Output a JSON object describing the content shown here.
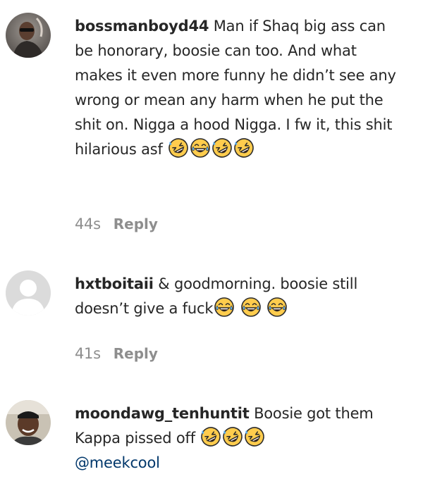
{
  "comments": [
    {
      "username": "bossmanboyd44",
      "text": " Man if Shaq big ass can be honorary, boosie can too. And what makes it even more funny he didn’t see any wrong or mean any harm when he put the shit on. Nigga a hood Nigga. I fw it, this shit hilarious asf",
      "emojis": [
        "rolling-laughing-emoji",
        "tears-of-joy-emoji",
        "rolling-laughing-emoji",
        "rolling-laughing-emoji"
      ],
      "time": "44s",
      "reply_label": "Reply",
      "avatar": "profile-photo"
    },
    {
      "username": "hxtboitaii",
      "text": " & goodmorning. boosie still doesn’t give a fuck",
      "emojis": [
        "tears-of-joy-emoji",
        "tears-of-joy-emoji",
        "tears-of-joy-emoji"
      ],
      "time": "41s",
      "reply_label": "Reply",
      "avatar": "default-avatar"
    },
    {
      "username": "moondawg_tenhuntit",
      "text": " Boosie got them Kappa pissed off",
      "emojis": [
        "rolling-laughing-emoji",
        "rolling-laughing-emoji",
        "rolling-laughing-emoji"
      ],
      "mention": "@meekcool",
      "avatar": "profile-photo"
    }
  ],
  "colors": {
    "text": "#262626",
    "meta": "#8e8e8e",
    "mention": "#00376b",
    "emoji_face": "#ffcc4d",
    "emoji_outline": "#2b2b2b"
  }
}
